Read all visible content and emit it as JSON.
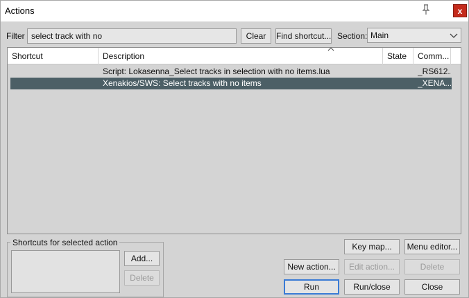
{
  "window": {
    "title": "Actions",
    "close_label": "x"
  },
  "toolbar": {
    "filter_label": "Filter",
    "filter_value": "select track with no",
    "clear_label": "Clear",
    "find_shortcut_label": "Find shortcut...",
    "section_label": "Section:",
    "section_value": "Main"
  },
  "table": {
    "columns": [
      "Shortcut",
      "Description",
      "State",
      "Comm..."
    ],
    "rows": [
      {
        "shortcut": "",
        "description": "Script: Lokasenna_Select tracks in selection with no items.lua",
        "state": "",
        "command": "_RS612...",
        "selected": false
      },
      {
        "shortcut": "",
        "description": "Xenakios/SWS: Select tracks with no items",
        "state": "",
        "command": "_XENA...",
        "selected": true
      }
    ]
  },
  "shortcuts_panel": {
    "title": "Shortcuts for selected action",
    "add_label": "Add...",
    "delete_label": "Delete"
  },
  "buttons": {
    "key_map": "Key map...",
    "menu_editor": "Menu editor...",
    "new_action": "New action...",
    "edit_action": "Edit action...",
    "delete": "Delete",
    "run": "Run",
    "run_close": "Run/close",
    "close": "Close"
  },
  "icons": {
    "pin": "pin-icon",
    "close": "close-icon",
    "dropdown": "chevron-down-icon",
    "sort": "sort-ascending-icon"
  },
  "colors": {
    "close_button": "#c42b1c",
    "selected_row": "#4c5f66",
    "default_button_border": "#3a7bd5"
  }
}
